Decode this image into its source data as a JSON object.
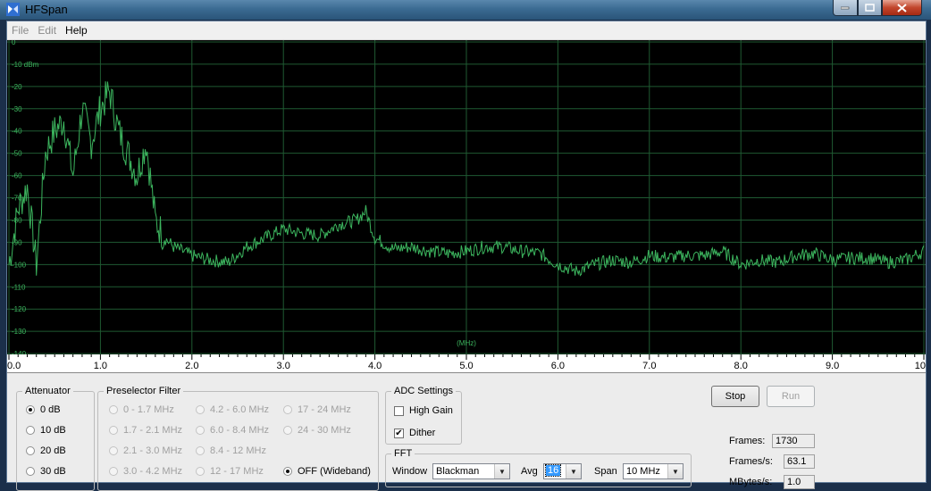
{
  "window": {
    "title": "HFSpan"
  },
  "menu": {
    "items": [
      "File",
      "Edit",
      "Help"
    ]
  },
  "chart_data": {
    "type": "line",
    "ylabel": "dBm",
    "xlabel": "(MHz)",
    "xlim": [
      0,
      10
    ],
    "ylim": [
      -150,
      0
    ],
    "y_tick_labels": [
      "0",
      "-10 dBm",
      "-20",
      "-30",
      "-40",
      "-50",
      "-60",
      "-70",
      "-80",
      "-90",
      "-100",
      "-110",
      "-120",
      "-130",
      "-140"
    ],
    "x_tick_labels": [
      "0.0",
      "1.0",
      "2.0",
      "3.0",
      "4.0",
      "5.0",
      "6.0",
      "7.0",
      "8.0",
      "9.0",
      "10"
    ],
    "grid": true,
    "series": [
      {
        "color": "#3cb55e",
        "x": [
          0.0,
          0.1,
          0.2,
          0.3,
          0.4,
          0.5,
          0.6,
          0.7,
          0.8,
          0.9,
          1.0,
          1.1,
          1.2,
          1.3,
          1.4,
          1.5,
          1.6,
          1.7,
          1.8,
          2.0,
          2.2,
          2.4,
          2.6,
          2.8,
          3.0,
          3.2,
          3.4,
          3.6,
          3.8,
          3.9,
          4.0,
          4.2,
          4.4,
          4.6,
          4.8,
          5.0,
          5.2,
          5.4,
          5.6,
          5.8,
          6.0,
          6.2,
          6.4,
          6.6,
          6.8,
          7.0,
          7.2,
          7.4,
          7.6,
          7.8,
          8.0,
          8.2,
          8.4,
          8.6,
          8.8,
          9.0,
          9.2,
          9.4,
          9.6,
          9.8,
          10.0
        ],
        "y": [
          -100,
          -75,
          -65,
          -100,
          -50,
          -40,
          -35,
          -60,
          -30,
          -45,
          -30,
          -22,
          -40,
          -50,
          -60,
          -45,
          -80,
          -88,
          -92,
          -96,
          -98,
          -99,
          -92,
          -88,
          -84,
          -86,
          -87,
          -82,
          -80,
          -76,
          -88,
          -93,
          -92,
          -94,
          -95,
          -94,
          -92,
          -92,
          -94,
          -95,
          -100,
          -103,
          -100,
          -98,
          -99,
          -96,
          -97,
          -96,
          -96,
          -94,
          -100,
          -98,
          -99,
          -96,
          -95,
          -98,
          -97,
          -97,
          -99,
          -98,
          -94
        ]
      }
    ]
  },
  "attenuator": {
    "label": "Attenuator",
    "options": [
      "0 dB",
      "10 dB",
      "20 dB",
      "30 dB"
    ],
    "selected": "0 dB"
  },
  "preselector": {
    "label": "Preselector Filter",
    "options": [
      "0 - 1.7 MHz",
      "1.7 - 2.1 MHz",
      "2.1 - 3.0 MHz",
      "3.0 - 4.2 MHz",
      "4.2 - 6.0 MHz",
      "6.0 - 8.4 MHz",
      "8.4 - 12 MHz",
      "12 - 17 MHz",
      "17 - 24 MHz",
      "24 - 30 MHz",
      "OFF (Wideband)"
    ],
    "selected": "OFF (Wideband)"
  },
  "adc": {
    "label": "ADC Settings",
    "high_gain": {
      "label": "High Gain",
      "checked": false
    },
    "dither": {
      "label": "Dither",
      "checked": true
    }
  },
  "fft": {
    "label": "FFT",
    "window_label": "Window",
    "window_value": "Blackman",
    "avg_label": "Avg",
    "avg_value": "16",
    "span_label": "Span",
    "span_value": "10 MHz"
  },
  "buttons": {
    "stop": "Stop",
    "run": "Run"
  },
  "stats": {
    "frames_label": "Frames:",
    "frames_value": "1730",
    "fps_label": "Frames/s:",
    "fps_value": "63.1",
    "mbps_label": "MBytes/s:",
    "mbps_value": "1.0"
  },
  "colors": {
    "plot_bg": "#000000",
    "grid": "#1f5a32",
    "trace": "#3cb55e",
    "label": "#3cb55e"
  }
}
